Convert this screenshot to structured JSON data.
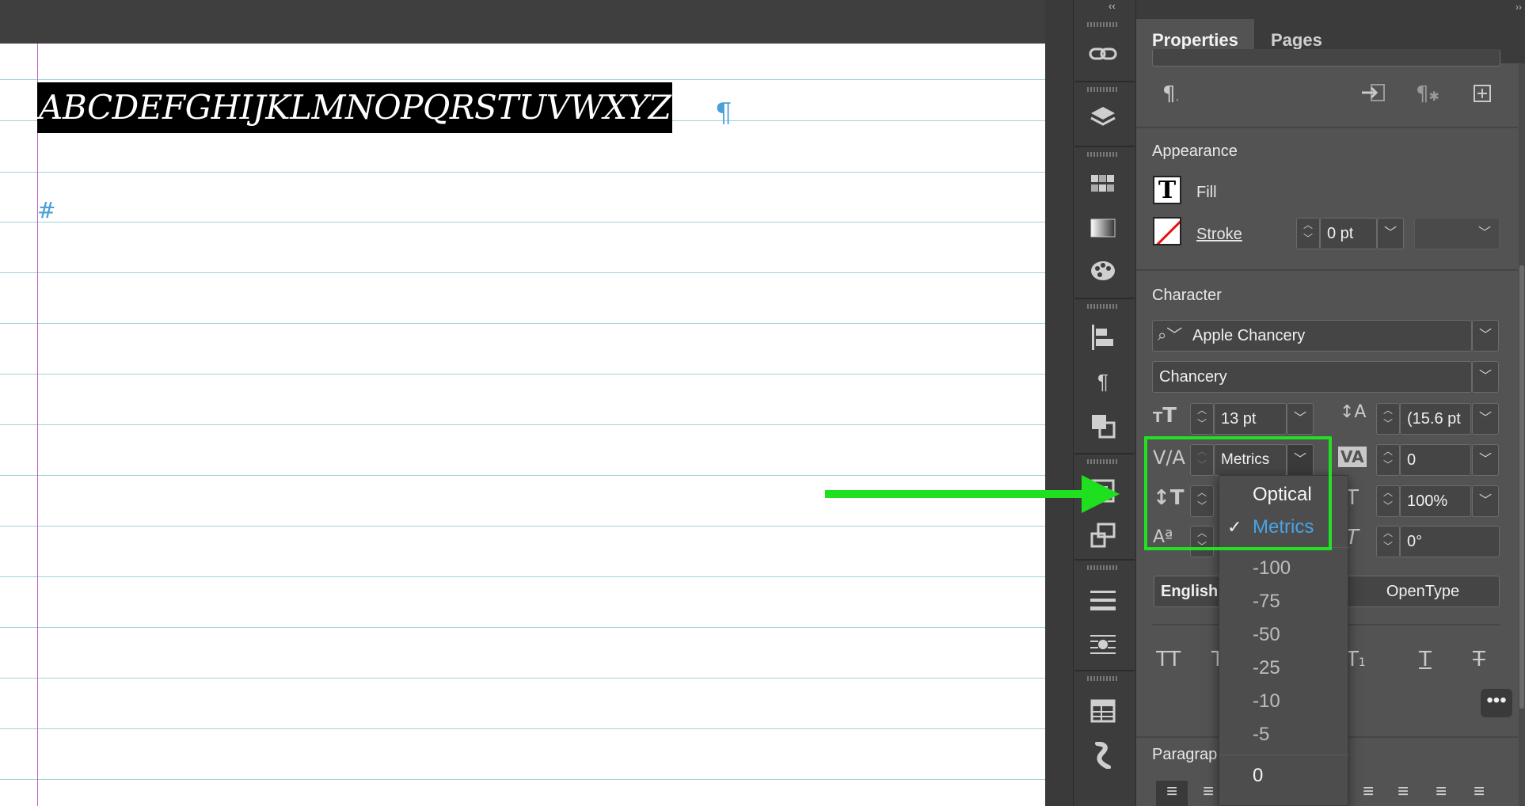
{
  "canvas": {
    "selected_text": "ABCDEFGHIJKLMNOPQRSTUVWXYZ",
    "pilcrow": "¶",
    "hash": "#"
  },
  "panel": {
    "collapse_glyph": "‹‹",
    "expand_glyph": "››",
    "tabs": [
      {
        "label": "Properties",
        "active": true
      },
      {
        "label": "Pages",
        "active": false
      }
    ],
    "top_icons": [
      "paragraph-style-icon",
      "convert-icon",
      "clear-override-icon",
      "new-style-icon"
    ],
    "appearance": {
      "title": "Appearance",
      "fill_label": "Fill",
      "stroke_label": "Stroke",
      "stroke_weight": "0 pt"
    },
    "character": {
      "title": "Character",
      "font_family": "Apple Chancery",
      "font_style": "Chancery",
      "font_size": "13 pt",
      "leading": "(15.6 pt",
      "kerning": "Metrics",
      "tracking": "0",
      "horizontal_scale": "100%",
      "skew": "0°",
      "language": "English:",
      "opentype_label": "OpenType"
    },
    "paragraph": {
      "title": "Paragrap"
    },
    "more_label": "•••"
  },
  "kerning_menu": {
    "items": [
      {
        "label": "Optical",
        "selected": false,
        "style": "bright"
      },
      {
        "label": "Metrics",
        "selected": true,
        "style": "selected"
      },
      {
        "label": "-100",
        "selected": false,
        "style": "dim"
      },
      {
        "label": "-75",
        "selected": false,
        "style": "dim"
      },
      {
        "label": "-50",
        "selected": false,
        "style": "dim"
      },
      {
        "label": "-25",
        "selected": false,
        "style": "dim"
      },
      {
        "label": "-10",
        "selected": false,
        "style": "dim"
      },
      {
        "label": "-5",
        "selected": false,
        "style": "dim"
      },
      {
        "label": "0",
        "selected": false,
        "style": "bright"
      }
    ],
    "check_glyph": "✓"
  },
  "colors": {
    "highlight": "#22e022",
    "selected_item": "#4aa3e6",
    "baseline_grid": "#9ed4d7",
    "margin_guide": "#c15fc7"
  }
}
